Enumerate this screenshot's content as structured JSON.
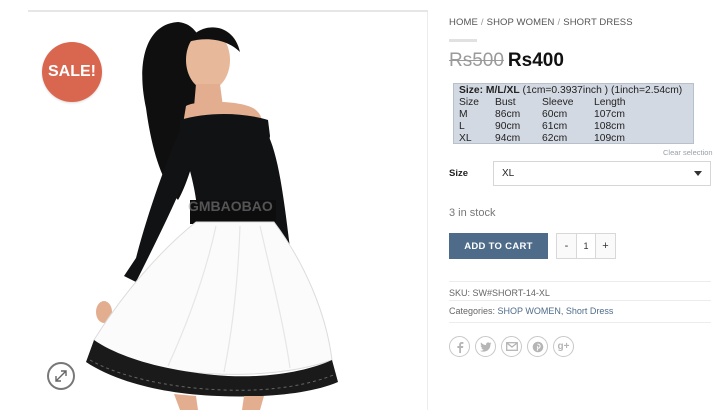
{
  "product": {
    "badge": "SALE!",
    "image_watermark": "GMBAOBAO"
  },
  "breadcrumb": {
    "items": [
      "HOME",
      "SHOP WOMEN",
      "SHORT DRESS"
    ],
    "separator": "/"
  },
  "price": {
    "old": "Rs500",
    "new": "Rs400"
  },
  "size_chart": {
    "size_label": "Size: M/L/XL",
    "conversion": "(1cm=0.3937inch ) (1inch=2.54cm)",
    "headers": [
      "Size",
      "Bust",
      "Sleeve",
      "Length"
    ],
    "rows": [
      [
        "M",
        "86cm",
        "60cm",
        "107cm"
      ],
      [
        "L",
        "90cm",
        "61cm",
        "108cm"
      ],
      [
        "XL",
        "94cm",
        "62cm",
        "109cm"
      ]
    ]
  },
  "variation": {
    "clear_label": "Clear selection",
    "size_label": "Size",
    "selected": "XL"
  },
  "stock": "3 in stock",
  "cart": {
    "button_label": "ADD TO CART",
    "minus": "-",
    "quantity": "1",
    "plus": "+"
  },
  "meta": {
    "sku": "SKU: SW#SHORT-14-XL",
    "categories_label": "Categories:",
    "categories": [
      "SHOP WOMEN",
      "Short Dress"
    ]
  },
  "share": {
    "icons": [
      "facebook-icon",
      "twitter-icon",
      "email-icon",
      "pinterest-icon",
      "googleplus-icon"
    ],
    "googleplus_text": "g+"
  },
  "colors": {
    "sale_badge": "#d9674f",
    "button": "#4e6c8a",
    "size_box": "#d3d9e2",
    "link": "#4e6c8a"
  }
}
